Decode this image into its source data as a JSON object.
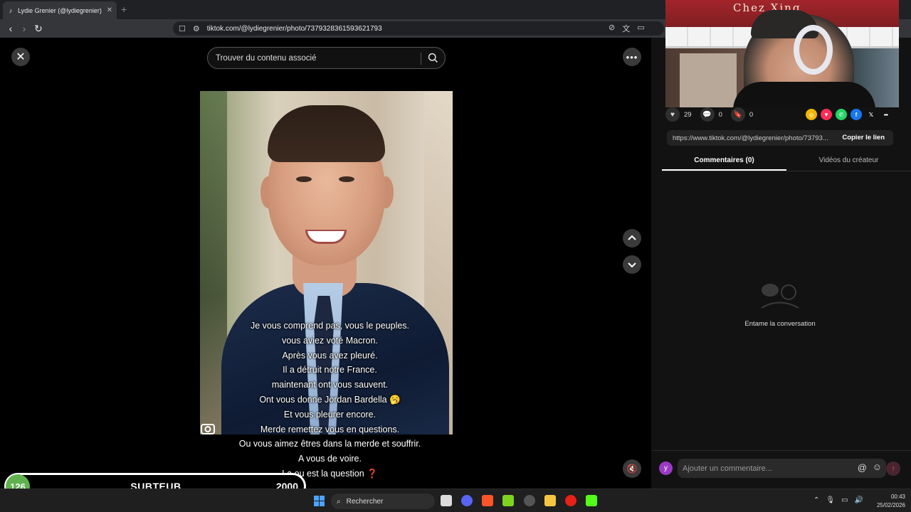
{
  "browser": {
    "tab_title": "Lydie Grenier (@lydiegrenier) | T",
    "tab_favicon": "♪",
    "tab_close": "✕",
    "new_tab": "+",
    "url": "tiktok.com/@lydiegrenier/photo/7379328361593621793"
  },
  "viewer": {
    "search_placeholder": "Trouver du contenu associé",
    "caption_lines": [
      "Je vous comprend pas, vous le peuples.",
      "vous aviez voté Macron.",
      "Après vous avez pleuré.",
      "Il a détruit notre France.",
      "maintenant ont vous sauvent.",
      "Ont vous donne Jordan Bardella 🥱",
      "Et vous pleurer encore.",
      "Merde remettez   vous en questions.",
      "Ou vous aimez êtres dans la merde et souffrir.",
      "A vous de  voire.",
      "La ou est la question ❓"
    ]
  },
  "side": {
    "likes": "29",
    "comments": "0",
    "saves": "0",
    "link": "https://www.tiktok.com/@lydiegrenier/photo/73793...",
    "copy_label": "Copier le lien",
    "tab_comments": "Commentaires (0)",
    "tab_videos": "Vidéos du créateur",
    "empty_text": "Entame la conversation",
    "comment_placeholder": "Ajouter un commentaire...",
    "avatar_letter": "y",
    "at_symbol": "@",
    "emoji_symbol": "☺",
    "share_colors": [
      "#f2b705",
      "#fe2c55",
      "#25d366",
      "#1877f2"
    ]
  },
  "cam": {
    "sign_text": "Chez Xing"
  },
  "overlay": {
    "count": "126",
    "label": "SUBTEUB",
    "goal": "2000"
  },
  "taskbar": {
    "search_label": "Rechercher",
    "time": "00:43",
    "date": "25/02/2026"
  }
}
